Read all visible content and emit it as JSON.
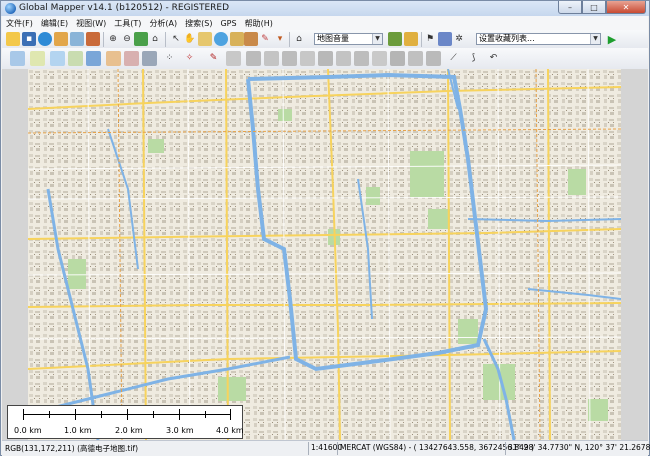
{
  "window": {
    "title": "Global Mapper v14.1 (b120512) - REGISTERED",
    "buttons": {
      "minimize": "–",
      "maximize": "□",
      "close": "✕"
    }
  },
  "menu": [
    "文件(F)",
    "编辑(E)",
    "视图(W)",
    "工具(T)",
    "分析(A)",
    "搜索(S)",
    "GPS",
    "帮助(H)"
  ],
  "toolbar": {
    "layer_combo": "地图音量",
    "config_combo": "设置收藏列表...",
    "run_icon": "play-icon"
  },
  "map": {
    "accent_road": "#f7d35d",
    "water": "#7fb3e6",
    "park": "#b9dba4",
    "background": "#efebe0"
  },
  "scalebar": {
    "labels": [
      "0.0 km",
      "1.0 km",
      "2.0 km",
      "3.0 km",
      "4.0 km"
    ]
  },
  "status": {
    "rgb": "RGB(131,172,211) (高德电子地图.tif)",
    "scale": "1:41600",
    "projection": "MERCAT (WGS84) - ( 13427643.558, 3672456.849 )",
    "latlon": "31° 28' 34.7730\" N, 120° 37' 21.2678\" E"
  }
}
